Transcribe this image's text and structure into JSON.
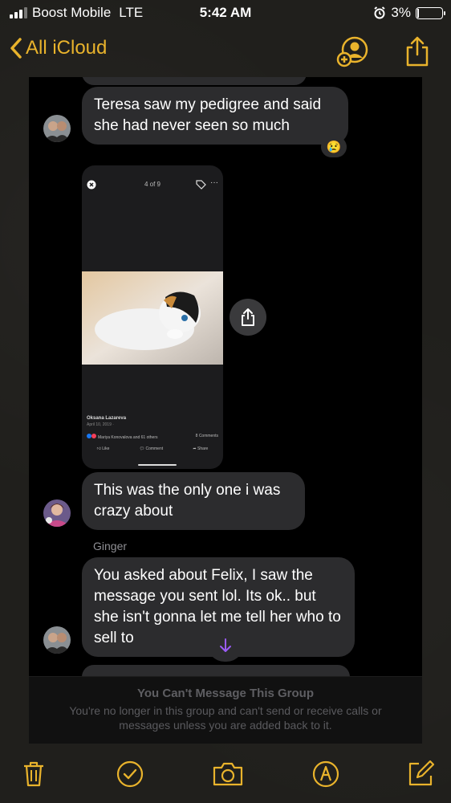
{
  "status_bar": {
    "carrier": "Boost Mobile",
    "network": "LTE",
    "time": "5:42 AM",
    "battery_percent": "3%",
    "battery_level": 0.03
  },
  "nav": {
    "back_label": "All iCloud"
  },
  "messages": {
    "msg1": "Teresa saw my pedigree and said she had never seen so much",
    "msg1_reaction": "😢",
    "msg2": "This was the only one i was crazy about",
    "sender_name": "Ginger",
    "msg3": "You asked about Felix, I saw the message you sent lol. Its ok.. but she isn't gonna let me tell her who to sell to"
  },
  "shared_screenshot": {
    "counter": "4 of 9",
    "poster_name": "Oksana Lazareva",
    "poster_date": "April 10, 2019 · ",
    "likes_text": "Mariya Konovalova and 61 others",
    "comments_text": "8 Comments",
    "like_label": "Like",
    "comment_label": "Comment",
    "share_label": "Share"
  },
  "banner": {
    "title": "You Can't Message This Group",
    "body": "You're no longer in this group and can't send or receive calls or messages unless you are added back to it."
  },
  "colors": {
    "accent": "#e9b32c",
    "bubble": "#2c2c2e",
    "scroll_arrow": "#9b5cf6"
  },
  "icons": {
    "nav": [
      "add-person-icon",
      "share-icon"
    ],
    "toolbar": [
      "trash-icon",
      "checklist-icon",
      "camera-icon",
      "markup-pen-icon",
      "compose-icon"
    ]
  }
}
